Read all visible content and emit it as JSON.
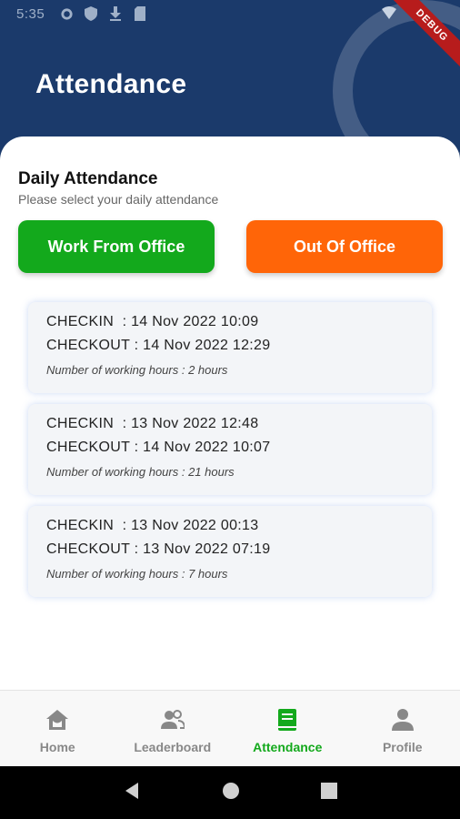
{
  "status_bar": {
    "time": "5:35"
  },
  "debug_label": "DEBUG",
  "header": {
    "title": "Attendance"
  },
  "section": {
    "title": "Daily Attendance",
    "subtitle": "Please select your daily attendance"
  },
  "actions": {
    "wfo_label": "Work From Office",
    "ooo_label": "Out Of Office",
    "wfo_color": "#13a91c",
    "ooo_color": "#ff6508"
  },
  "records": [
    {
      "checkin": "CHECKIN  : 14 Nov 2022 10:09",
      "checkout": "CHECKOUT : 14 Nov 2022 12:29",
      "hours": "Number of working hours : 2 hours"
    },
    {
      "checkin": "CHECKIN  : 13 Nov 2022 12:48",
      "checkout": "CHECKOUT : 14 Nov 2022 10:07",
      "hours": "Number of working hours : 21 hours"
    },
    {
      "checkin": "CHECKIN  : 13 Nov 2022 00:13",
      "checkout": "CHECKOUT : 13 Nov 2022 07:19",
      "hours": "Number of working hours : 7 hours"
    }
  ],
  "bottom_nav": {
    "items": [
      {
        "label": "Home",
        "icon": "home-icon"
      },
      {
        "label": "Leaderboard",
        "icon": "people-icon"
      },
      {
        "label": "Attendance",
        "icon": "book-icon",
        "active": true
      },
      {
        "label": "Profile",
        "icon": "person-icon"
      }
    ],
    "active_color": "#13a91c"
  }
}
